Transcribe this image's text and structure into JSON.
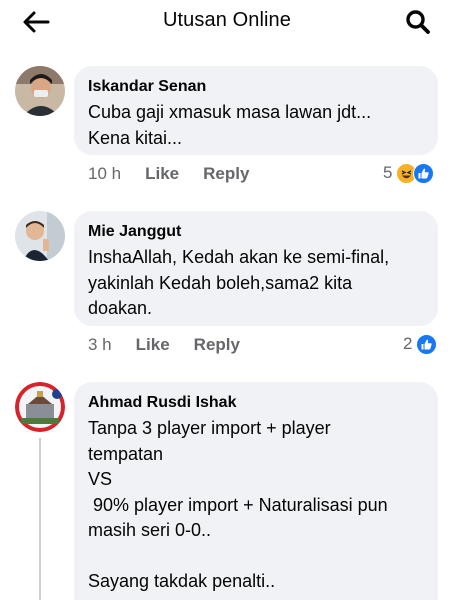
{
  "header": {
    "title": "Utusan Online",
    "back_icon": "arrow-left-icon",
    "search_icon": "search-icon"
  },
  "colors": {
    "bubble": "#f0f2f5",
    "secondary_text": "#65676b",
    "like_blue": "#1877f2",
    "haha_yellow": "#f7b125"
  },
  "comments": [
    {
      "author": "Iskandar Senan",
      "text": "Cuba gaji xmasuk masa lawan jdt...\nKena kitai...",
      "time": "10 h",
      "like_label": "Like",
      "reply_label": "Reply",
      "reaction_count": "5",
      "reaction_icons": [
        "haha-icon",
        "like-icon"
      ]
    },
    {
      "author": "Mie Janggut",
      "text": "InshaAllah, Kedah akan ke semi-final,\nyakinlah Kedah boleh,sama2 kita\ndoakan.",
      "time": "3 h",
      "like_label": "Like",
      "reply_label": "Reply",
      "reaction_count": "2",
      "reaction_icons": [
        "like-icon"
      ]
    },
    {
      "author": "Ahmad Rusdi Ishak",
      "text": "Tanpa 3 player import + player\ntempatan\nVS\n 90% player import + Naturalisasi pun\nmasih seri 0-0..\n\nSayang takdak penalti..",
      "reaction_icons": []
    }
  ]
}
